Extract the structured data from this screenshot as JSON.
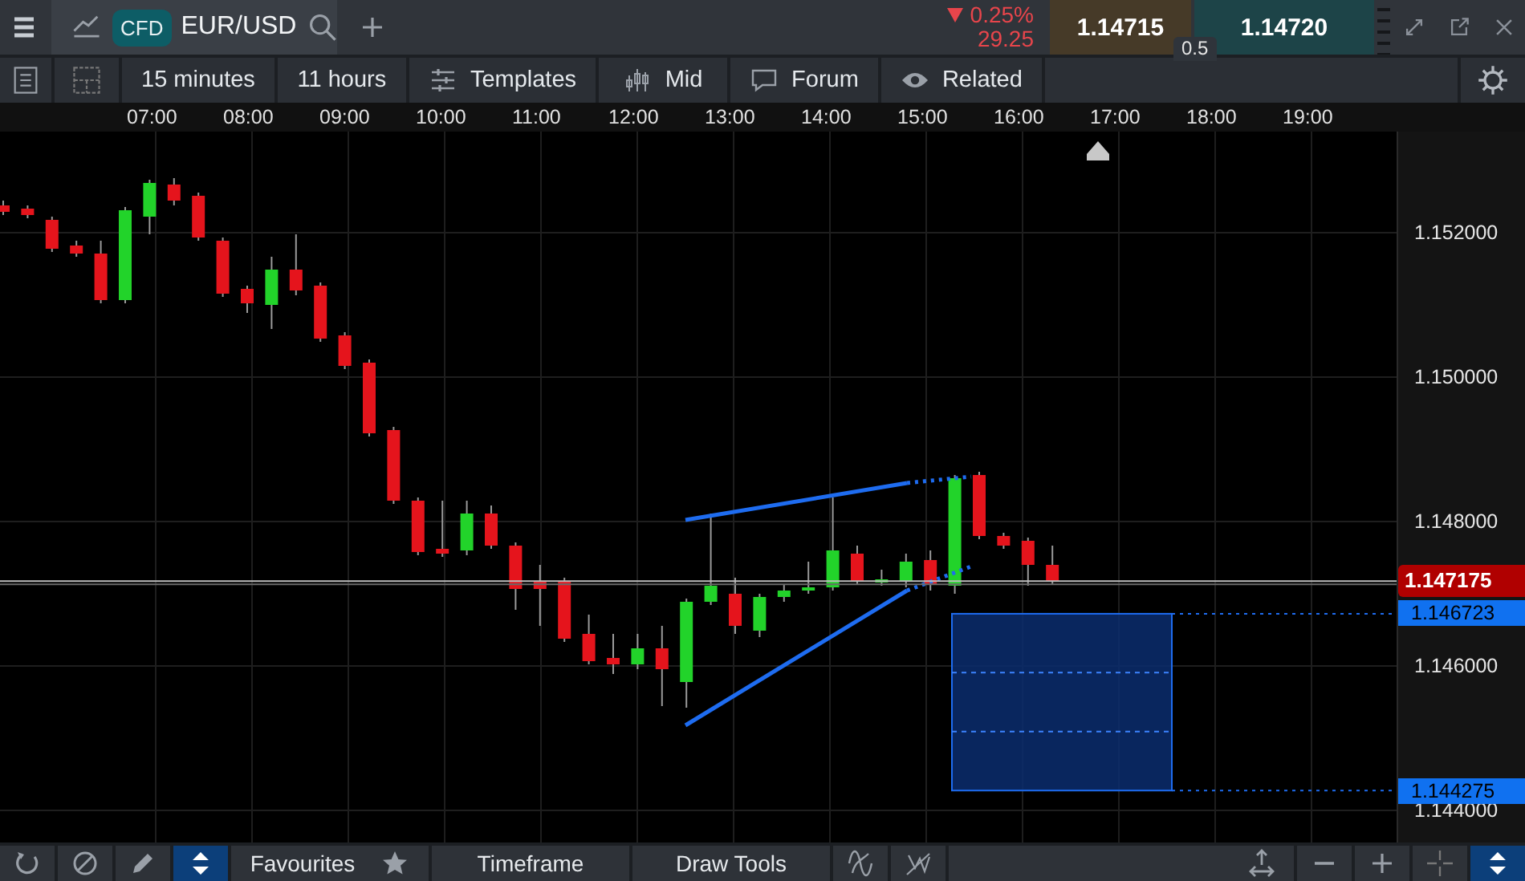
{
  "header": {
    "tab": {
      "badge": "CFD",
      "symbol": "EUR/USD"
    },
    "change": {
      "falling": true,
      "percent": "0.25%",
      "points": "29.25"
    },
    "sell": "1.14715",
    "buy": "1.14720",
    "spread": "0.5"
  },
  "toolbar": [
    {
      "kind": "icon"
    },
    {
      "kind": "icon"
    },
    {
      "kind": "text",
      "label": "15 minutes"
    },
    {
      "kind": "text",
      "label": "11 hours"
    },
    {
      "kind": "text",
      "label": "Templates"
    },
    {
      "kind": "text",
      "label": "Mid"
    },
    {
      "kind": "text",
      "label": "Forum"
    },
    {
      "kind": "text",
      "label": "Related"
    }
  ],
  "time_axis": [
    "07:00",
    "08:00",
    "09:00",
    "10:00",
    "11:00",
    "12:00",
    "13:00",
    "14:00",
    "15:00",
    "16:00",
    "17:00",
    "18:00",
    "19:00"
  ],
  "price_axis": [
    "1.152000",
    "1.150000",
    "1.148000",
    "1.146000",
    "1.144000"
  ],
  "price_labels": [
    {
      "kind": "current",
      "value": "1.147175"
    },
    {
      "kind": "order",
      "value": "1.146723"
    },
    {
      "kind": "order",
      "value": "1.144275"
    }
  ],
  "bottom_left": [
    {
      "kind": "icon",
      "selected": false
    },
    {
      "kind": "icon",
      "selected": false
    },
    {
      "kind": "icon",
      "selected": false
    },
    {
      "kind": "icon",
      "selected": true
    },
    {
      "kind": "text",
      "label": "Favourites",
      "selected": false
    },
    {
      "kind": "text",
      "label": "Timeframe",
      "selected": false
    },
    {
      "kind": "text",
      "label": "Draw Tools",
      "selected": false
    },
    {
      "kind": "icon",
      "selected": false
    },
    {
      "kind": "icon",
      "selected": false
    }
  ],
  "bottom_right": [
    {
      "kind": "icon",
      "selected": false
    },
    {
      "kind": "icon",
      "selected": false
    },
    {
      "kind": "icon",
      "selected": false
    },
    {
      "kind": "icon",
      "selected": true
    }
  ]
}
